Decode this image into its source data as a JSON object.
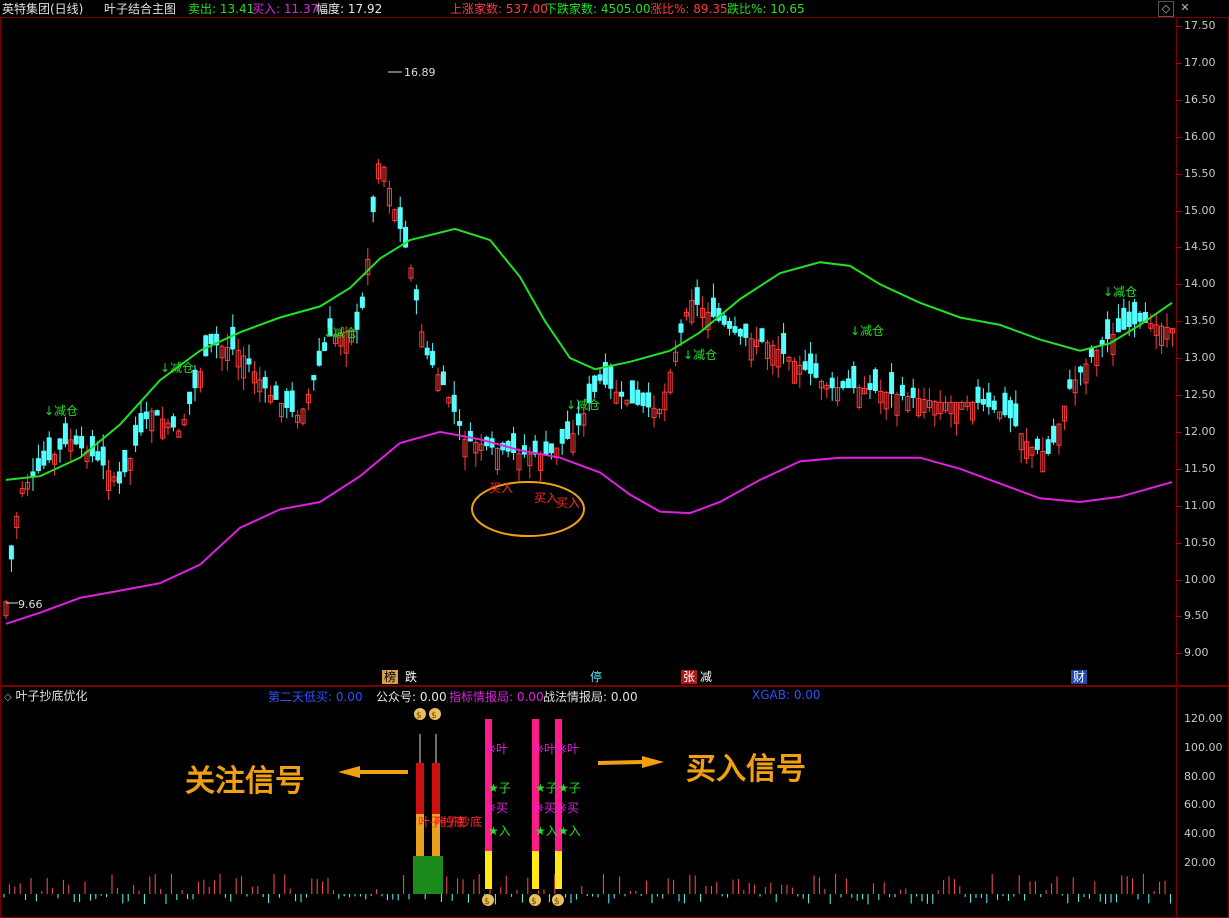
{
  "header": {
    "stock_name": "英特集团(日线)",
    "indicator_name": "叶子结合主图",
    "sell_label": "卖出: 13.41",
    "buy_label": "买入: 11.37",
    "range_label": "幅度: 17.92",
    "up_count": "上涨家数: 537.00",
    "down_count": "下跌家数: 4505.00",
    "up_ratio": "涨比%: 89.35",
    "down_ratio": "跌比%: 10.65"
  },
  "price_axis": [
    "17.50",
    "17.00",
    "16.50",
    "16.00",
    "15.50",
    "15.00",
    "14.50",
    "14.00",
    "13.50",
    "13.00",
    "12.50",
    "12.00",
    "11.50",
    "11.00",
    "10.50",
    "10.00",
    "9.50",
    "9.00"
  ],
  "price_markers": {
    "high": "16.89",
    "low": "9.66"
  },
  "signals_main": {
    "reduce": "↓减仓",
    "buy": "买入"
  },
  "event_tags": [
    {
      "text": "榜",
      "bg": "#d4a04a",
      "color": "#000"
    },
    {
      "text": "跌",
      "bg": "#000",
      "color": "#fff"
    },
    {
      "text": "停",
      "bg": "#000",
      "color": "#5ce8ff"
    },
    {
      "text": "张",
      "bg": "#b01818",
      "color": "#fff"
    },
    {
      "text": "减",
      "bg": "#000",
      "color": "#fff"
    },
    {
      "text": "财",
      "bg": "#1c4ab0",
      "color": "#fff"
    }
  ],
  "sub_header": {
    "title": "叶子抄底优化",
    "second_day": "第二天低买: 0.00",
    "official": "公众号: 0.00",
    "intel": "指标情报局: 0.00",
    "tactics": "战法情报局: 0.00",
    "xgab": "XGAB: 0.00"
  },
  "sub_axis": [
    "120.00",
    "100.00",
    "80.00",
    "60.00",
    "40.00",
    "20.00"
  ],
  "sub_signals": {
    "bottom_text": "叶子抄底",
    "leaf": "※叶",
    "zi": "★子",
    "mai": "※买",
    "ru": "★入"
  },
  "annotations": {
    "watch": "关注信号",
    "buy": "买入信号"
  },
  "colors": {
    "up": "#ff3c3c",
    "down": "#54ffff",
    "ma_green": "#22e022",
    "ma_magenta": "#e020e0",
    "grid": "#7a0000",
    "annotation": "#f0a010"
  }
}
